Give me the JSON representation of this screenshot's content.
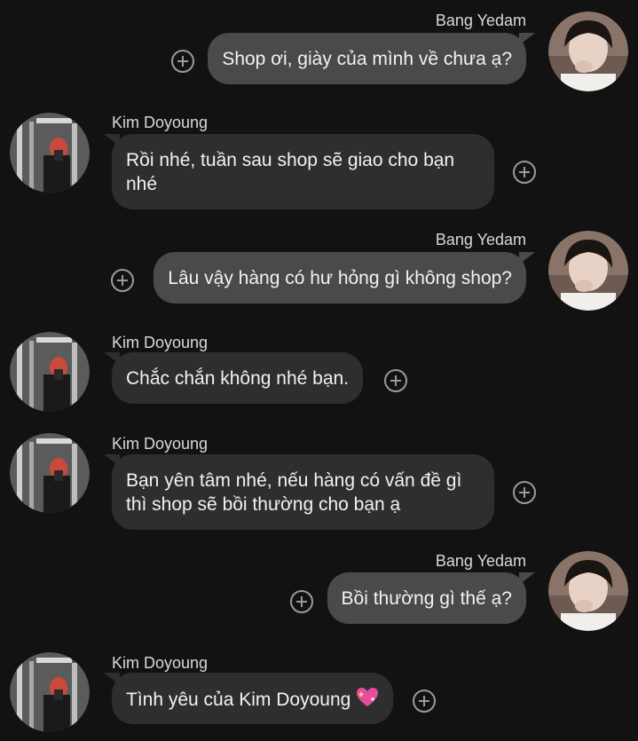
{
  "users": {
    "self": {
      "name": "Bang Yedam"
    },
    "other": {
      "name": "Kim Doyoung"
    }
  },
  "messages": [
    {
      "sender": "Bang Yedam",
      "text": "Shop ơi, giày của mình về chưa ạ?",
      "direction": "outgoing"
    },
    {
      "sender": "Kim Doyoung",
      "text": "Rồi nhé, tuần sau shop sẽ giao cho bạn nhé",
      "direction": "incoming"
    },
    {
      "sender": "Bang Yedam",
      "text": "Lâu vậy hàng có hư hỏng gì không shop?",
      "direction": "outgoing"
    },
    {
      "sender": "Kim Doyoung",
      "text": "Chắc chắn không nhé bạn.",
      "direction": "incoming"
    },
    {
      "sender": "Kim Doyoung",
      "text": "Bạn yên tâm nhé, nếu hàng có vấn đề gì thì shop sẽ bồi thường cho bạn ạ",
      "direction": "incoming"
    },
    {
      "sender": "Bang Yedam",
      "text": "Bồi thường gì thế ạ?",
      "direction": "outgoing"
    },
    {
      "sender": "Kim Doyoung",
      "text": "Tình yêu của Kim Doyoung",
      "emoji": "sparkling-heart-icon",
      "direction": "incoming"
    }
  ],
  "colors": {
    "background": "#121212",
    "outgoing_bubble": "#4a4a4a",
    "incoming_bubble": "#2e2e2e",
    "text": "#f2f2f2",
    "name": "#d9d9d9",
    "add_reaction": "#9a9a9a"
  }
}
